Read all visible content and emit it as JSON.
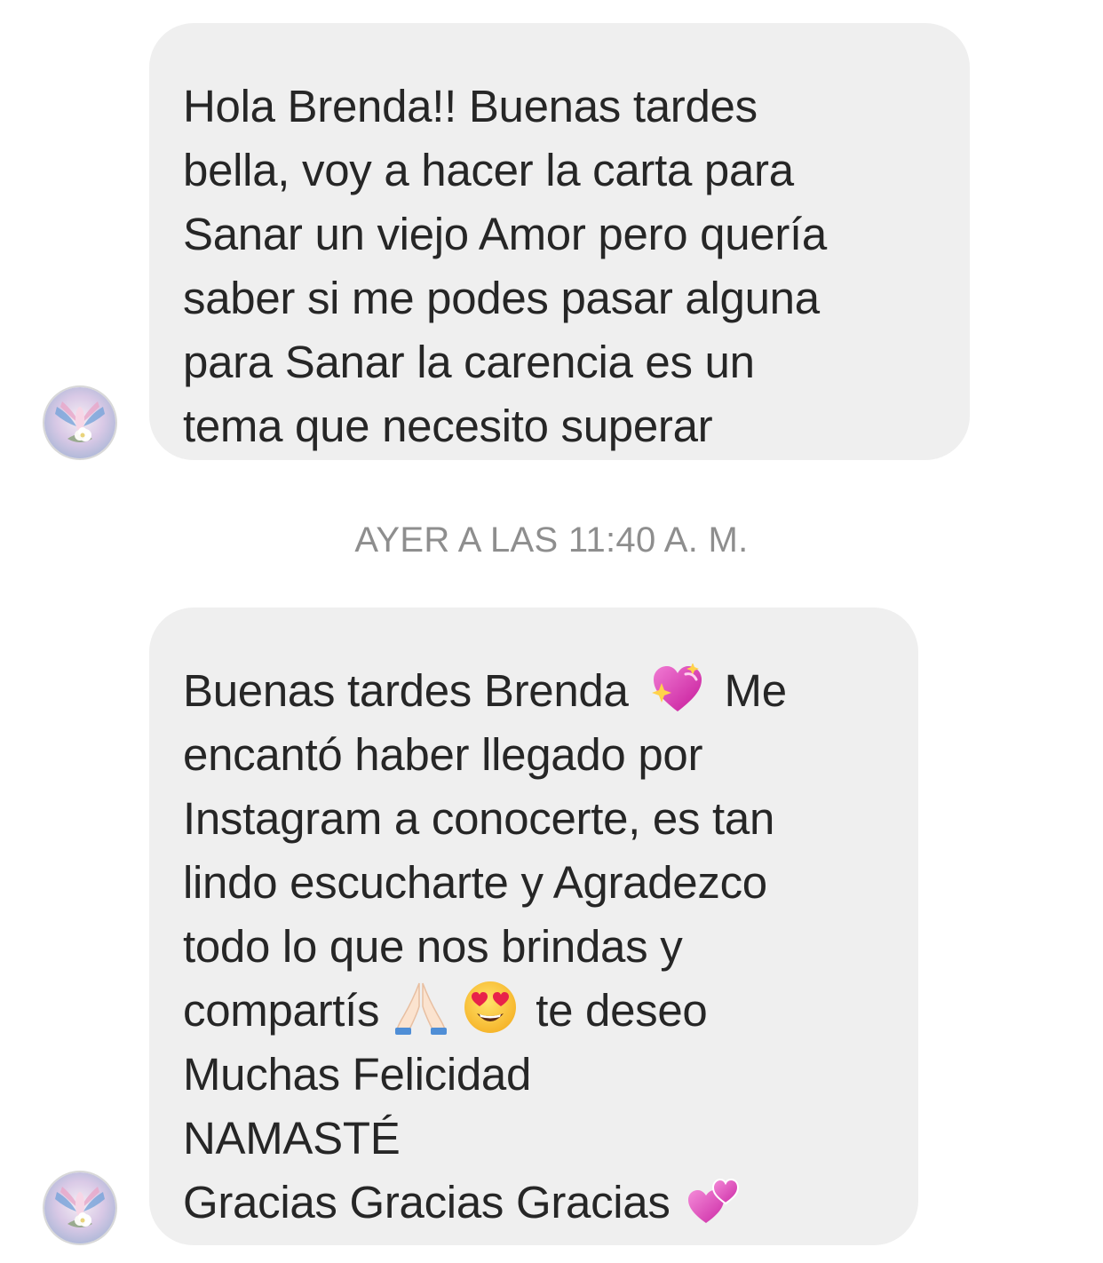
{
  "conversation": {
    "messages": [
      {
        "sender": "received",
        "lines": [
          "Hola Brenda!! Buenas tardes",
          "bella, voy a hacer la carta para",
          "Sanar un viejo Amor pero quería",
          "saber si me podes pasar alguna",
          "para Sanar la carencia es un",
          "tema que necesito superar"
        ]
      },
      {
        "sender": "received",
        "lines": [
          "Buenas tardes Brenda",
          "Me",
          "encantó haber llegado por",
          "Instagram a conocerte, es tan",
          "lindo escucharte y Agradezco",
          "todo lo que nos brindas y",
          "compartís",
          "te deseo",
          "Muchas Felicidad",
          "NAMASTÉ",
          "Gracias Gracias Gracias"
        ]
      }
    ],
    "timestamp": "AYER A LAS 11:40 A. M."
  },
  "emojis": {
    "sparkling_heart": "sparkling-heart-icon",
    "folded_hands": "folded-hands-icon",
    "heart_eyes": "heart-eyes-icon",
    "two_hearts": "two-hearts-icon"
  },
  "colors": {
    "bubble_background": "#efefef",
    "text": "#262626",
    "timestamp": "#8e8e8e",
    "background": "#ffffff"
  }
}
